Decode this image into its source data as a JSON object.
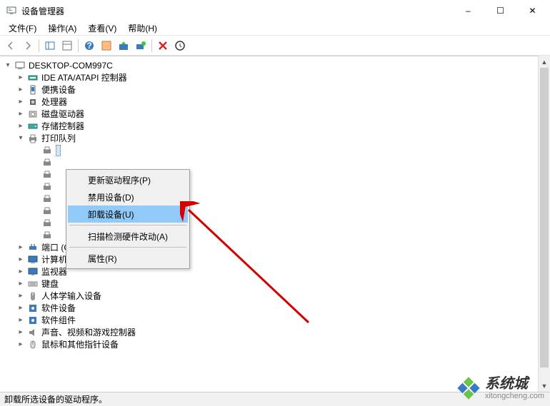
{
  "window": {
    "title": "设备管理器",
    "controls": {
      "min": "–",
      "max": "☐",
      "close": "✕"
    }
  },
  "menus": {
    "file": "文件(F)",
    "action": "操作(A)",
    "view": "查看(V)",
    "help": "帮助(H)"
  },
  "tree": {
    "root": "DESKTOP-COM997C",
    "nodes": [
      {
        "label": "IDE ATA/ATAPI 控制器",
        "icon": "ide"
      },
      {
        "label": "便携设备",
        "icon": "portable"
      },
      {
        "label": "处理器",
        "icon": "cpu"
      },
      {
        "label": "磁盘驱动器",
        "icon": "disk"
      },
      {
        "label": "存储控制器",
        "icon": "storage"
      }
    ],
    "print_queue": {
      "label": "打印队列"
    },
    "after": [
      {
        "label": "端口 (COM 和 LPT)",
        "icon": "port"
      },
      {
        "label": "计算机",
        "icon": "computer"
      },
      {
        "label": "监视器",
        "icon": "monitor"
      },
      {
        "label": "键盘",
        "icon": "keyboard"
      },
      {
        "label": "人体学输入设备",
        "icon": "hid"
      },
      {
        "label": "软件设备",
        "icon": "soft"
      },
      {
        "label": "软件组件",
        "icon": "soft"
      },
      {
        "label": "声音、视频和游戏控制器",
        "icon": "sound"
      },
      {
        "label": "鼠标和其他指针设备",
        "icon": "mouse"
      }
    ]
  },
  "context": {
    "update": "更新驱动程序(P)",
    "disable": "禁用设备(D)",
    "uninstall": "卸载设备(U)",
    "scan": "扫描检测硬件改动(A)",
    "props": "属性(R)"
  },
  "status": "卸载所选设备的驱动程序。",
  "watermark": {
    "cn": "系统城",
    "en": "xitongcheng.com"
  }
}
